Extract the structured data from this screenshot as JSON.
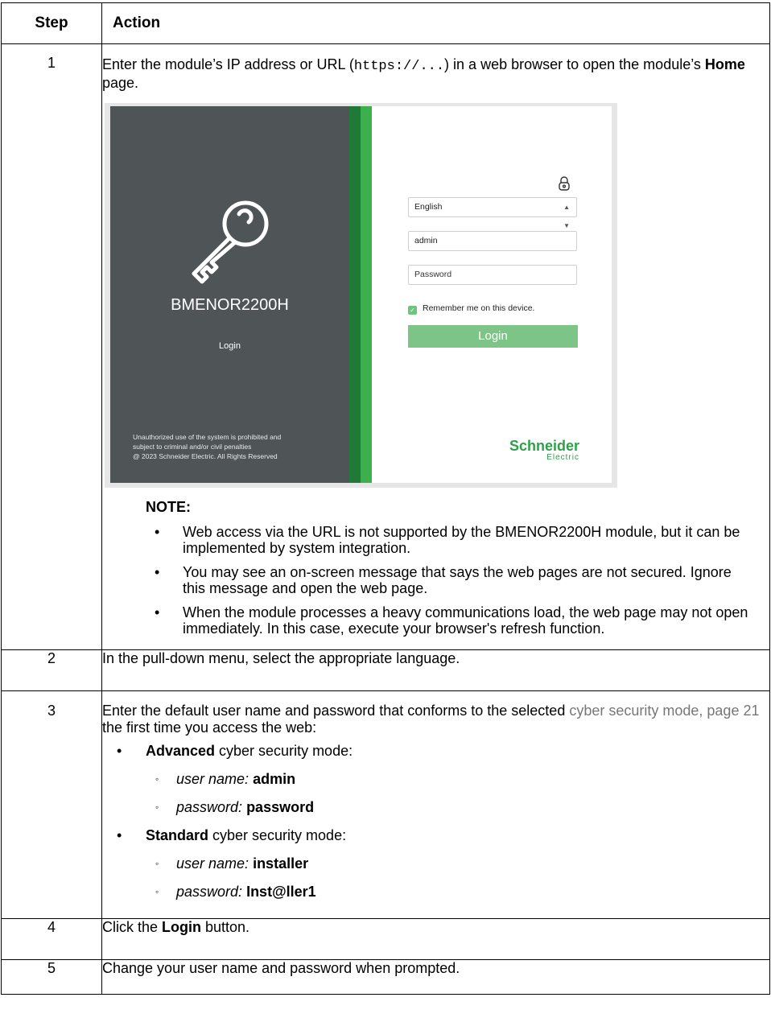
{
  "table": {
    "headers": {
      "step": "Step",
      "action": "Action"
    },
    "step1": {
      "number": "1",
      "text_a": "Enter the module’s IP address or URL (",
      "url_code": "https://...",
      "text_b": ") in a web browser to open the module’s ",
      "bold": "Home",
      "text_c": " page.",
      "screenshot": {
        "device_name": "BMENOR2200H",
        "login_caption": "Login",
        "legal_lines": [
          "Unauthorized use of the system is prohibited and",
          "subject to criminal and/or civil penalties",
          "@ 2023 Schneider Electric. All Rights Reserved"
        ],
        "language_value": "English",
        "username_value": "admin",
        "password_placeholder": "Password",
        "remember_label": "Remember me on this device.",
        "login_button": "Login",
        "logo_main": "Schneider",
        "logo_sub": "Electric",
        "icons": {
          "key": "key-icon",
          "lock": "lock-icon",
          "select_arrows": "updown-arrows-icon",
          "checkbox": "checkmark-icon"
        },
        "colors": {
          "left_panel": "#4f5556",
          "stripe_dark": "#1f7a37",
          "stripe_light": "#3bb04c",
          "button": "#7cc586",
          "logo": "#2ea04a"
        }
      },
      "note_title": "NOTE:",
      "notes": [
        "Web access via the URL is not supported by the BMENOR2200H module, but it can be implemented by system integration.",
        "You may see an on-screen message that says the web pages are not secured. Ignore this message and open the web page.",
        "When the module processes a heavy communications load, the web page may not open immediately. In this case, execute your browser's refresh function."
      ]
    },
    "step2": {
      "number": "2",
      "text": "In the pull-down menu, select the appropriate language."
    },
    "step3": {
      "number": "3",
      "text_a": "Enter the default user name and password that conforms to the selected ",
      "link": "cyber security mode, page 21",
      "text_b": " the first time you access the web:",
      "modes": [
        {
          "bold": "Advanced",
          "rest": " cyber security mode:",
          "username_label": "user name:",
          "username": "admin",
          "password_label": "password:",
          "password": "password"
        },
        {
          "bold": "Standard",
          "rest": " cyber security mode:",
          "username_label": "user name:",
          "username": "installer",
          "password_label": "password:",
          "password": "Inst@ller1"
        }
      ]
    },
    "step4": {
      "number": "4",
      "text_a": "Click the ",
      "bold": "Login",
      "text_b": " button."
    },
    "step5": {
      "number": "5",
      "text": "Change your user name and password when prompted."
    }
  }
}
